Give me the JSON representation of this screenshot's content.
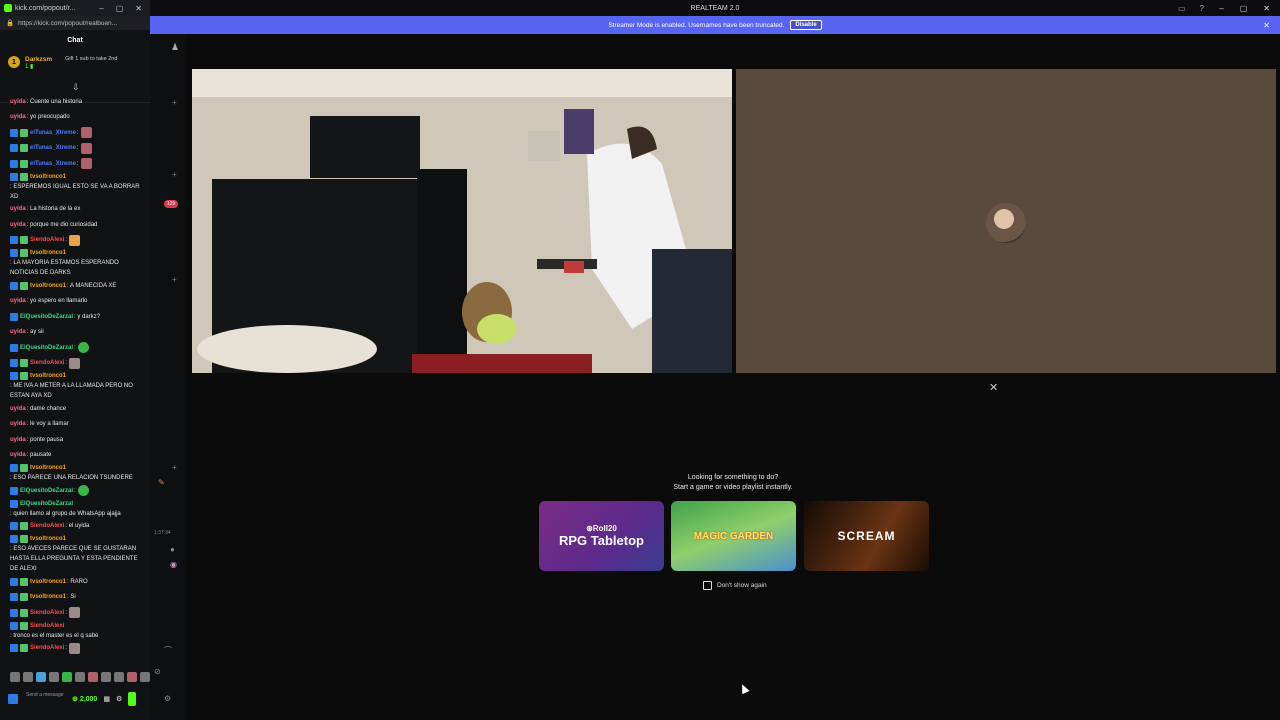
{
  "popout": {
    "title": "kick.com/popout/r...",
    "url": "https://kick.com/popout/realbuen...",
    "header": "Chat",
    "pinned": {
      "badge": "1",
      "user": "Darkzsm",
      "sub": "1 ▮",
      "gift_text": "Gift 1 sub to take 2nd"
    },
    "messages": [
      {
        "user": "uyida",
        "text": ": Cuente una historia",
        "color": "#ff6b8b",
        "badges": 0
      },
      {
        "user": "uyida",
        "text": ": yo preocupado",
        "color": "#ff6b8b",
        "badges": 0
      },
      {
        "user": "elTunas_Xtreme",
        "text": ":",
        "color": "#4a7dff",
        "badges": 2,
        "emote": "r"
      },
      {
        "user": "elTunas_Xtreme",
        "text": ":",
        "color": "#4a7dff",
        "badges": 2,
        "emote": "r"
      },
      {
        "user": "elTunas_Xtreme",
        "text": ":",
        "color": "#4a7dff",
        "badges": 2,
        "emote": "r"
      },
      {
        "user": "tvsoltronco1",
        "text": ": ESPEREMOS IGUAL ESTO SE VA A BORRAR XD",
        "color": "#f5a623",
        "badges": 2,
        "size": "tall"
      },
      {
        "user": "uyida",
        "text": ": La historia de la ex",
        "color": "#ff6b8b",
        "badges": 0
      },
      {
        "user": "uyida",
        "text": ": porque me dio curiosidad",
        "color": "#ff6b8b",
        "badges": 0
      },
      {
        "user": "SiendoAlexi",
        "text": ":",
        "color": "#ff4d4d",
        "badges": 2,
        "emote": "y"
      },
      {
        "user": "tvsoltronco1",
        "text": ": LA MAYORIA ESTAMOS ESPERANDO NOTICIAS DE DARKS",
        "color": "#f5a623",
        "badges": 2,
        "size": "big"
      },
      {
        "user": "tvsoltronco1",
        "text": ": A MANECIDA XE",
        "color": "#f5a623",
        "badges": 2
      },
      {
        "user": "uyida",
        "text": ": yo espero en llamarlo",
        "color": "#ff6b8b",
        "badges": 0
      },
      {
        "user": "ElQuesitoDeZarzal",
        "text": ": y darkz?",
        "color": "#39d98a",
        "badges": 1
      },
      {
        "user": "uyida",
        "text": ": ay sii",
        "color": "#ff6b8b",
        "badges": 0
      },
      {
        "user": "ElQuesitoDeZarzal",
        "text": ":",
        "color": "#39d98a",
        "badges": 1,
        "emote": "g"
      },
      {
        "user": "SiendoAlexi",
        "text": ":",
        "color": "#ff4d4d",
        "badges": 2,
        "emote": "p"
      },
      {
        "user": "tvsoltronco1",
        "text": ": ME IVA A METER A LA LLAMADA PERO NO ESTAN AYA XD",
        "color": "#f5a623",
        "badges": 2,
        "size": "tall"
      },
      {
        "user": "uyida",
        "text": ": dame chance",
        "color": "#ff6b8b",
        "badges": 0
      },
      {
        "user": "uyida",
        "text": ": le voy a llamar",
        "color": "#ff6b8b",
        "badges": 0
      },
      {
        "user": "uyida",
        "text": ": ponte pausa",
        "color": "#ff6b8b",
        "badges": 0
      },
      {
        "user": "uyida",
        "text": ": pausate",
        "color": "#ff6b8b",
        "badges": 0
      },
      {
        "user": "tvsoltronco1",
        "text": ": ESO PARECE UNA RELACION TSUNDERE",
        "color": "#f5a623",
        "badges": 2,
        "size": "tall"
      },
      {
        "user": "ElQuesitoDeZarzal",
        "text": ":",
        "color": "#39d98a",
        "badges": 1,
        "emote": "g"
      },
      {
        "user": "ElQuesitoDeZarzal",
        "text": ": quien llamo al grupo de WhatsApp ajajja",
        "color": "#39d98a",
        "badges": 1,
        "size": "tall"
      },
      {
        "user": "SiendoAlexi",
        "text": ": el uyida",
        "color": "#ff4d4d",
        "badges": 2
      },
      {
        "user": "tvsoltronco1",
        "text": ": ESO AVECES PARECE QUE SE GUSTARAN HASTA ELLA PREGUNTA Y ESTA PENDIENTE DE ALEXI",
        "color": "#f5a623",
        "badges": 2,
        "size": "big"
      },
      {
        "user": "tvsoltronco1",
        "text": ": RARO",
        "color": "#f5a623",
        "badges": 2
      },
      {
        "user": "tvsoltronco1",
        "text": ": Si",
        "color": "#f5a623",
        "badges": 2
      },
      {
        "user": "SiendoAlexi",
        "text": ":",
        "color": "#ff4d4d",
        "badges": 2,
        "emote": "p"
      },
      {
        "user": "SiendoAlexi",
        "text": ": tronco es el master es el q sabe",
        "color": "#ff4d4d",
        "badges": 2,
        "size": "tall"
      },
      {
        "user": "SiendoAlexi",
        "text": ":",
        "color": "#ff4d4d",
        "badges": 2,
        "emote": "p"
      }
    ],
    "input_placeholder": "Send a message",
    "points": "2,000"
  },
  "strip": {
    "unread_count": "129",
    "timestamp": "1:37:34"
  },
  "window": {
    "title": "REALTEAM 2.0"
  },
  "banner": {
    "text": "Streamer Mode is enabled. Usernames have been truncated.",
    "button": "Disable"
  },
  "launcher": {
    "line1": "Looking for something to do?",
    "line2": "Start a game or video playlist instantly.",
    "cards": [
      {
        "brand": "⊛Roll20",
        "title": "RPG Tabletop"
      },
      {
        "title": "MAGIC GARDEN"
      },
      {
        "title": "SCREAM"
      }
    ],
    "dont_show": "Don't show again"
  }
}
